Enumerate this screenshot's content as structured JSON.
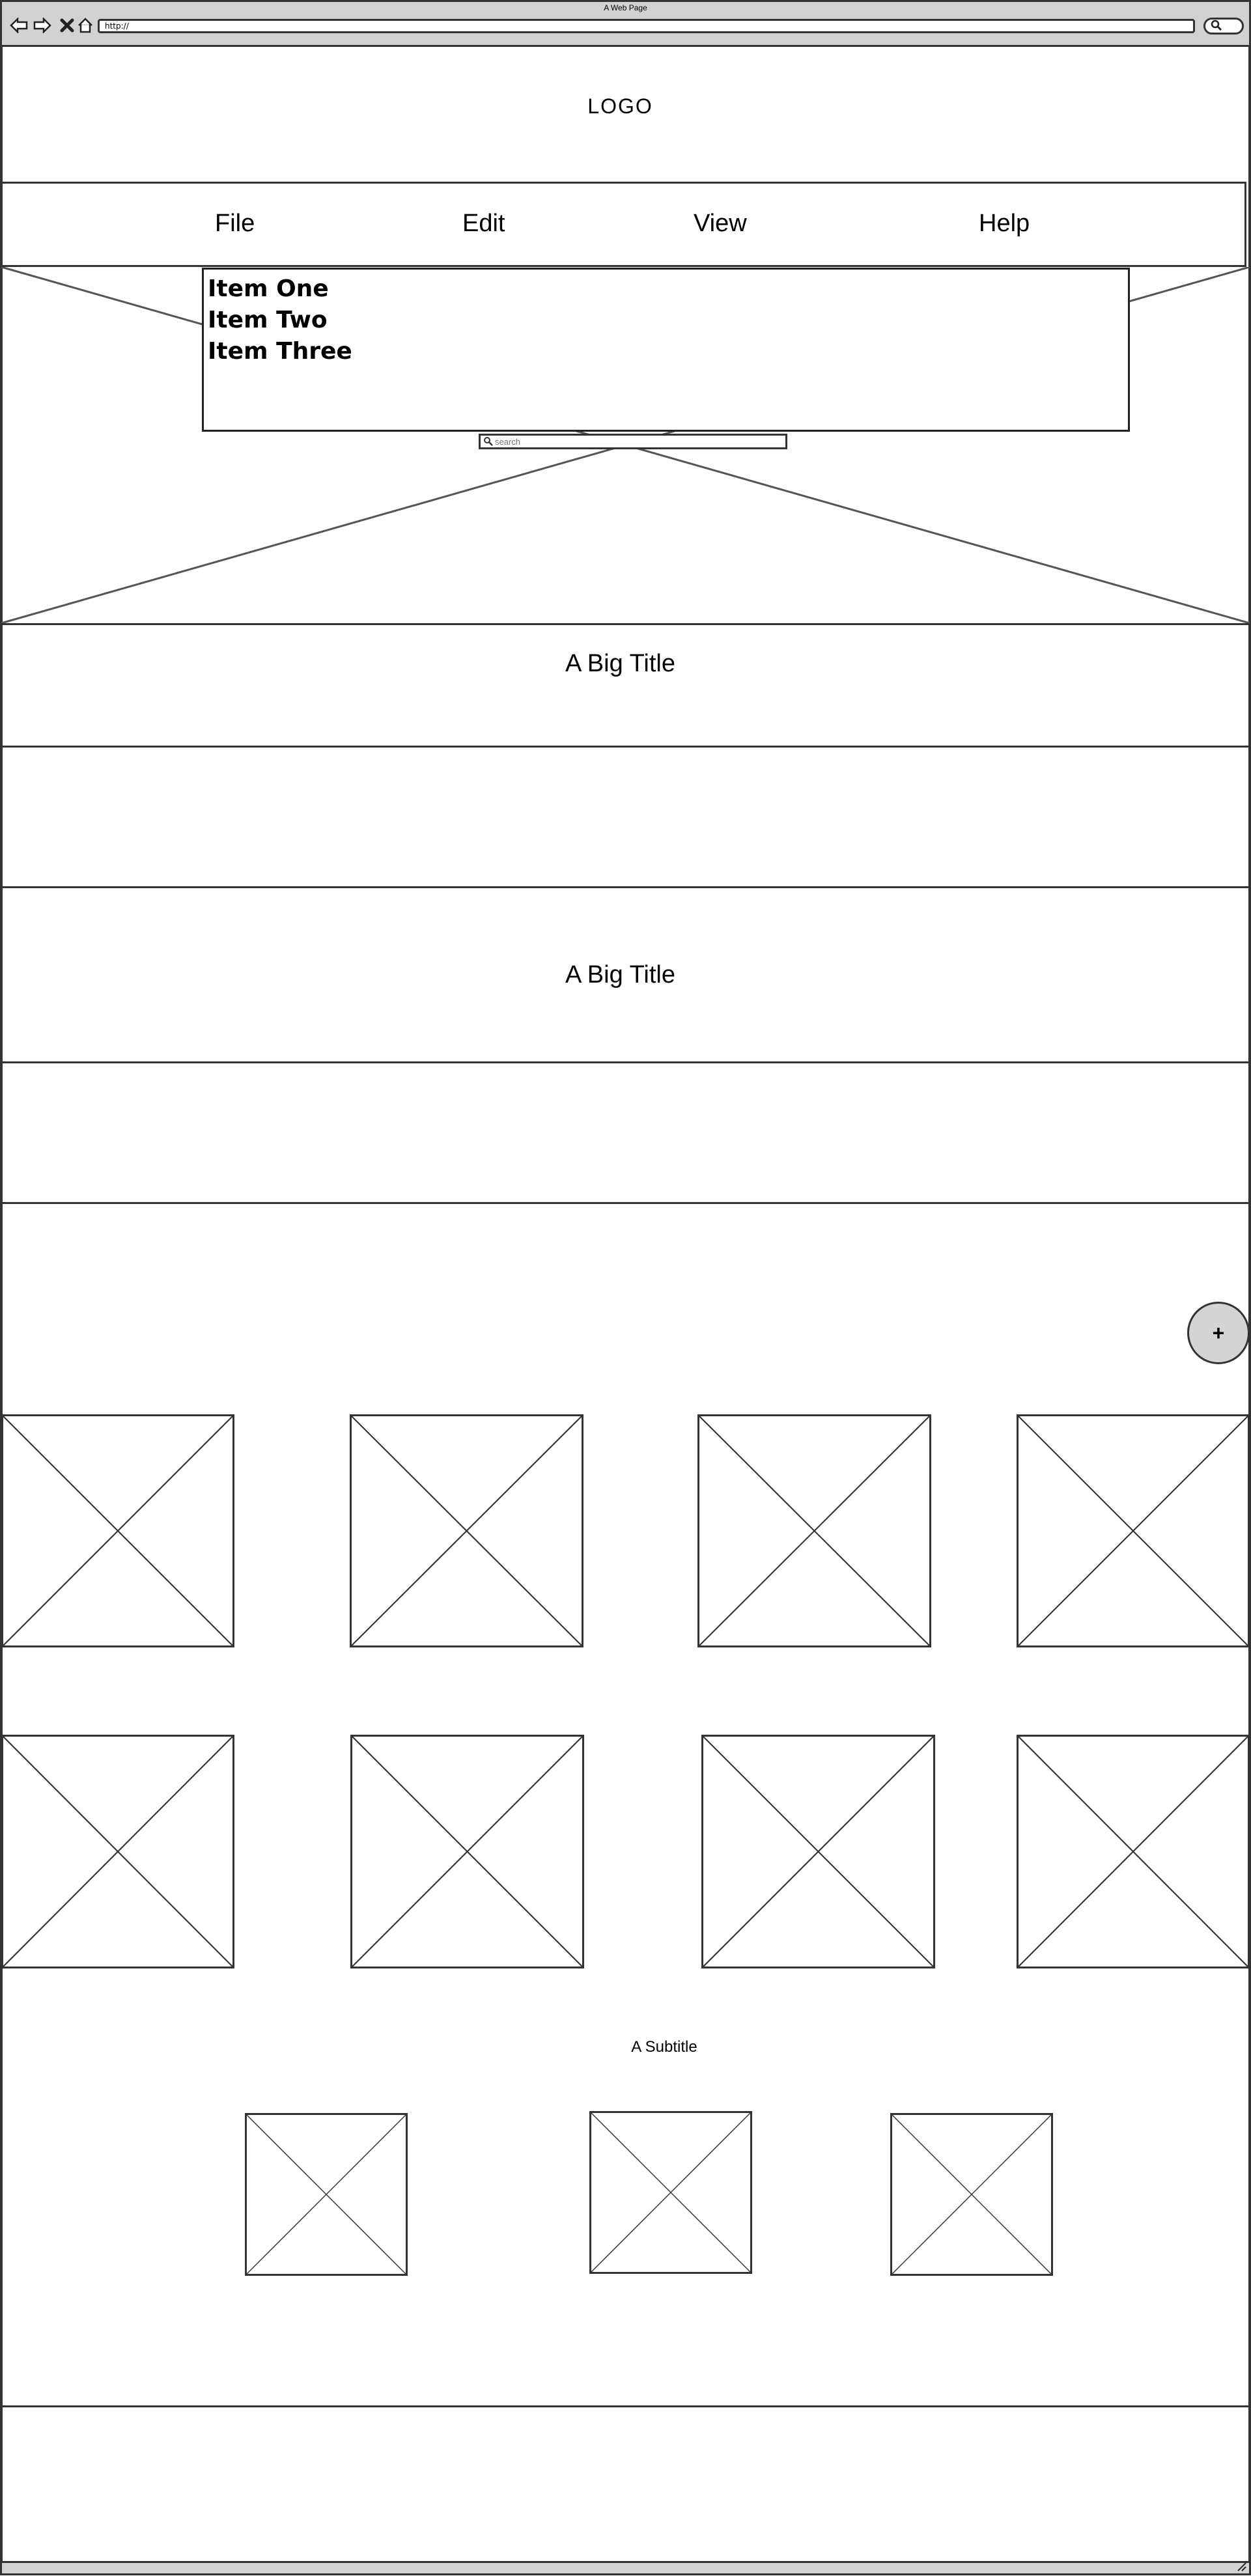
{
  "browser": {
    "window_title": "A Web Page",
    "url": "http://",
    "icons": [
      "back-arrow-icon",
      "forward-arrow-icon",
      "close-x-icon",
      "home-icon",
      "search-icon"
    ]
  },
  "header": {
    "logo": "LOGO"
  },
  "menu": {
    "items": [
      "File",
      "Edit",
      "View",
      "Help"
    ]
  },
  "dropdown": {
    "items": [
      "Item One",
      "Item Two",
      "Item Three"
    ]
  },
  "search": {
    "placeholder": "search"
  },
  "sections": {
    "title_1": "A Big Title",
    "title_2": "A Big Title",
    "subtitle": "A Subtitle"
  },
  "fab": {
    "label": "+"
  }
}
